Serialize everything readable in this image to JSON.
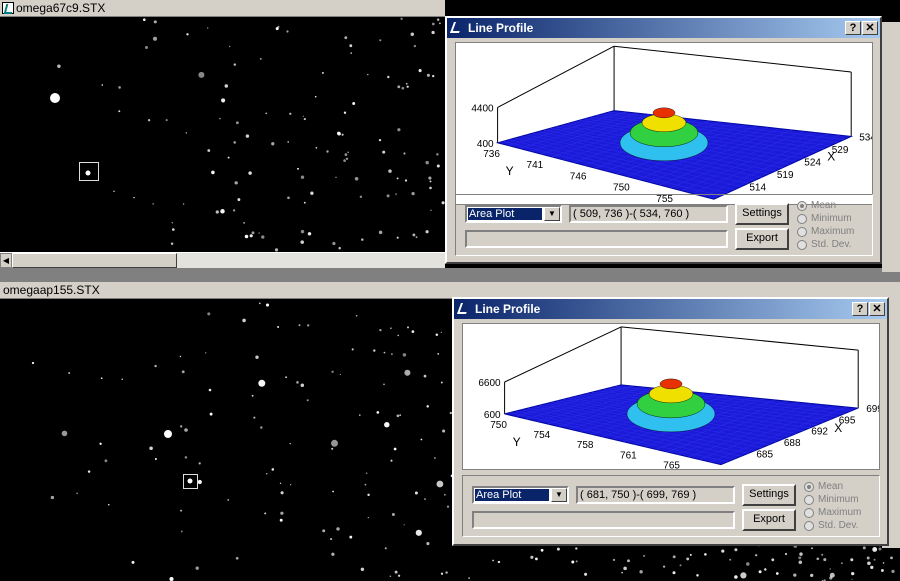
{
  "window1": {
    "title": "omega67c9.STX"
  },
  "window2": {
    "title": "omegaap155.STX"
  },
  "dialog1": {
    "title": "Line Profile",
    "help": "?",
    "close": "✕",
    "combo": "Area Plot",
    "range": "( 509, 736 )-( 534, 760 )",
    "settings": "Settings",
    "export": "Export",
    "radios": [
      "Mean",
      "Minimum",
      "Maximum",
      "Std. Dev."
    ],
    "selected_radio": "Mean",
    "plot": {
      "z_ticks": [
        "4400",
        "400"
      ],
      "y_ticks": [
        "736",
        "741",
        "746",
        "750",
        "755",
        "509"
      ],
      "x_ticks": [
        "514",
        "519",
        "524",
        "529",
        "534"
      ],
      "y_label": "Y",
      "x_label": "X"
    }
  },
  "dialog2": {
    "title": "Line Profile",
    "help": "?",
    "close": "✕",
    "combo": "Area Plot",
    "range": "( 681, 750 )-( 699, 769 )",
    "settings": "Settings",
    "export": "Export",
    "radios": [
      "Mean",
      "Minimum",
      "Maximum",
      "Std. Dev."
    ],
    "selected_radio": "Mean",
    "plot": {
      "z_ticks": [
        "6600",
        "600"
      ],
      "y_ticks": [
        "750",
        "754",
        "758",
        "761",
        "765",
        "681"
      ],
      "x_ticks": [
        "685",
        "688",
        "692",
        "695",
        "699"
      ],
      "y_label": "Y",
      "x_label": "X"
    }
  },
  "colors": {
    "surface_base": "#1a1ad8",
    "peak": "#e83000",
    "mid": "#f0e000",
    "green": "#30d040",
    "cyan": "#30c0f0"
  }
}
